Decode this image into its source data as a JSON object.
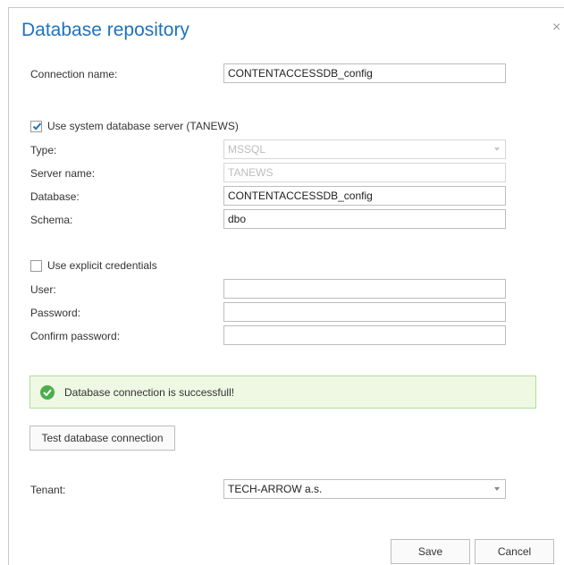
{
  "dialog": {
    "title": "Database repository",
    "close_glyph": "×"
  },
  "connection": {
    "label": "Connection name:",
    "value": "CONTENTACCESSDB_config"
  },
  "system_server": {
    "checkbox_label": "Use system database server (TANEWS)",
    "checked": true,
    "type_label": "Type:",
    "type_value": "MSSQL",
    "server_label": "Server name:",
    "server_value": "TANEWS",
    "database_label": "Database:",
    "database_value": "CONTENTACCESSDB_config",
    "schema_label": "Schema:",
    "schema_value": "dbo"
  },
  "credentials": {
    "checkbox_label": "Use explicit credentials",
    "checked": false,
    "user_label": "User:",
    "user_value": "",
    "password_label": "Password:",
    "password_value": "",
    "confirm_label": "Confirm password:",
    "confirm_value": ""
  },
  "status": {
    "message": "Database connection is successfull!",
    "icon": "check-circle-icon",
    "color": "#4cae4c"
  },
  "test_button_label": "Test database connection",
  "tenant": {
    "label": "Tenant:",
    "value": "TECH-ARROW a.s."
  },
  "footer": {
    "save_label": "Save",
    "cancel_label": "Cancel"
  },
  "colors": {
    "title": "#1e73be",
    "success_bg": "#eef8e3",
    "success_border": "#b6dc96"
  }
}
